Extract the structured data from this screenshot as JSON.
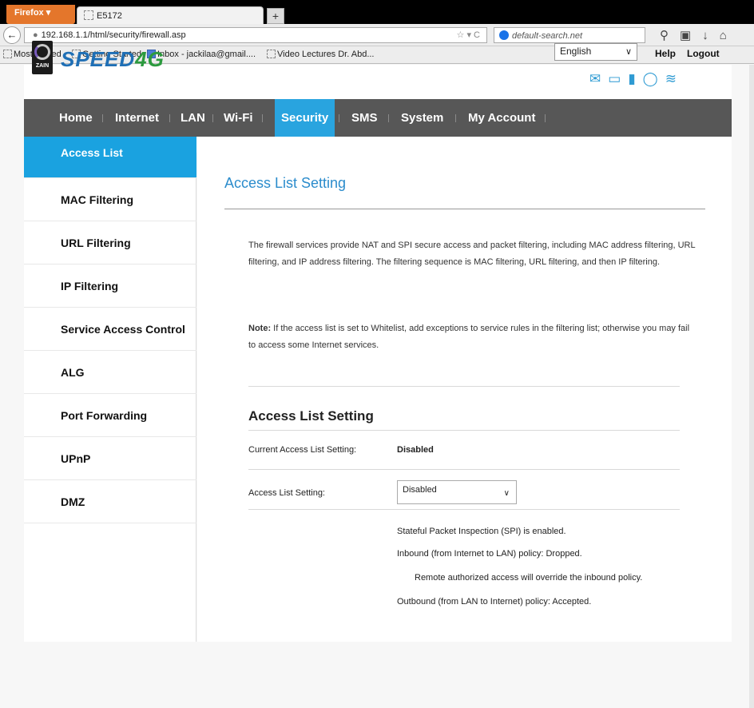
{
  "browser": {
    "firefox_button": "Firefox ▾",
    "tab_title": "E5172",
    "new_tab": "+",
    "url": "192.168.1.1/html/security/firewall.asp",
    "search_text": "default-search.net",
    "bookmarks": [
      "Most Visited",
      "Getting Started",
      "Inbox - jackilaa@gmail....",
      "Video Lectures  Dr. Abd..."
    ]
  },
  "header": {
    "brand_prefix": "SPEED",
    "brand_suffix": "4G",
    "logo_text": "ZAIN",
    "language": "English",
    "help": "Help",
    "logout": "Logout"
  },
  "mainnav": [
    "Home",
    "Internet",
    "LAN",
    "Wi-Fi",
    "Security",
    "SMS",
    "System",
    "My Account"
  ],
  "sidebar": [
    "Access List",
    "MAC Filtering",
    "URL Filtering",
    "IP Filtering",
    "Service Access Control",
    "ALG",
    "Port Forwarding",
    "UPnP",
    "DMZ"
  ],
  "content": {
    "page_title": "Access List Setting",
    "description": "The firewall services provide NAT and SPI secure access and packet filtering, including MAC address filtering, URL filtering, and IP address filtering. The filtering sequence is MAC filtering, URL filtering, and then IP filtering.",
    "note_label": "Note:",
    "note_text": " If the access list is set to Whitelist, add exceptions to service rules in the filtering list; otherwise you may fail to access some Internet services.",
    "section_title": "Access List Setting",
    "current_label": "Current Access List Setting:",
    "current_value": "Disabled",
    "setting_label": "Access List Setting:",
    "setting_value": "Disabled",
    "info": [
      "Stateful Packet Inspection (SPI) is enabled.",
      "Inbound (from Internet to LAN) policy: Dropped.",
      "Remote authorized access will override the inbound policy.",
      "Outbound (from LAN to Internet) policy: Accepted."
    ]
  },
  "colors": {
    "accent": "#1aa2e0",
    "nav_bg": "#575757",
    "title": "#2b8ccc"
  }
}
